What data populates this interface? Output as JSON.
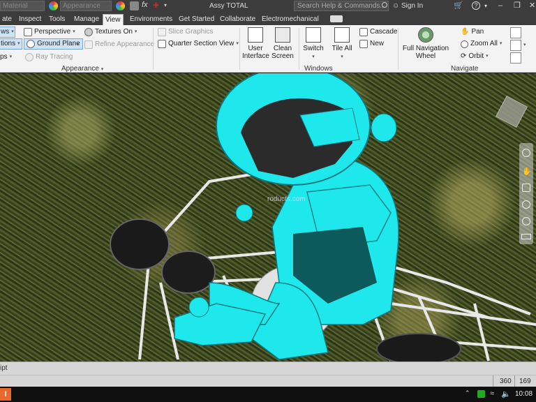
{
  "titlebar": {
    "material": "Material",
    "appearance": "Appearance",
    "doc_title": "Assy TOTAL",
    "search_placeholder": "Search Help & Commands...",
    "signin": "Sign In",
    "help": "?",
    "minimize": "–",
    "restore": "❐"
  },
  "tabs": [
    "ate",
    "Inspect",
    "Tools",
    "Manage",
    "View",
    "Environments",
    "Get Started",
    "Collaborate",
    "Electromechanical"
  ],
  "active_tab": "View",
  "ribbon": {
    "left_cut": {
      "views": "ws",
      "options": "tions",
      "ops": "ps"
    },
    "appearance": {
      "perspective": "Perspective",
      "textures_on": "Textures On",
      "ground_plane": "Ground Plane",
      "refine_appearance": "Refine Appearance",
      "ray_tracing": "Ray Tracing",
      "slice_graphics": "Slice Graphics",
      "quarter_section_view": "Quarter Section View",
      "group_label": "Appearance"
    },
    "windows": {
      "user_interface": "User\nInterface",
      "clean_screen": "Clean\nScreen",
      "switch": "Switch",
      "tile_all": "Tile All",
      "cascade": "Cascade",
      "new": "New",
      "group_label": "Windows"
    },
    "navigate": {
      "full_navigation_wheel": "Full Navigation\nWheel",
      "pan": "Pan",
      "zoom_all": "Zoom All",
      "orbit": "Orbit",
      "group_label": "Navigate"
    }
  },
  "viewport": {
    "watermark": "roducts.com"
  },
  "status": {
    "text": "ipt",
    "x": "360",
    "y": "169"
  },
  "taskbar": {
    "app_letter": "I",
    "time": "10:08"
  }
}
